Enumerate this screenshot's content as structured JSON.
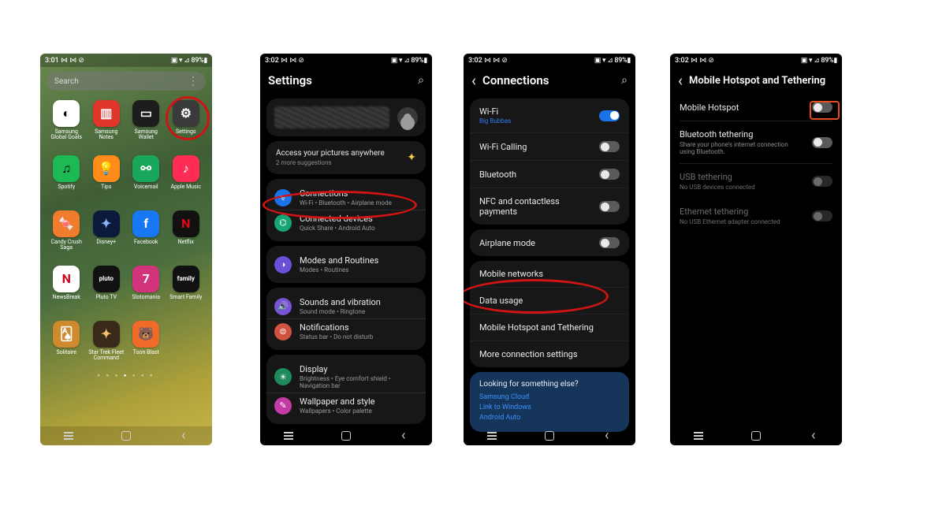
{
  "status": {
    "time1": "3:01",
    "time2": "3:02",
    "icons_left": " ⋈ ⋈ ⊘",
    "right": "▣ ▾ ⊿ 89%▮"
  },
  "screen1": {
    "search_placeholder": "Search",
    "apps": [
      {
        "label": "Samsung",
        "label2": "Global Goals",
        "bg": "#ffffff",
        "fg": "#000",
        "glyph": "◐"
      },
      {
        "label": "Samsung",
        "label2": "Notes",
        "bg": "#e0352b",
        "fg": "#fff",
        "glyph": "▥"
      },
      {
        "label": "Samsung",
        "label2": "Wallet",
        "bg": "#1d1d1d",
        "fg": "#fff",
        "glyph": "▭"
      },
      {
        "label": "Settings",
        "label2": "",
        "bg": "#3a3a3a",
        "fg": "#fff",
        "glyph": "⚙"
      },
      {
        "label": "Spotify",
        "label2": "",
        "bg": "#1db954",
        "fg": "#000",
        "glyph": "♫"
      },
      {
        "label": "Tips",
        "label2": "",
        "bg": "#ff8c1a",
        "fg": "#fff",
        "glyph": "💡"
      },
      {
        "label": "Voicemail",
        "label2": "",
        "bg": "#19a85b",
        "fg": "#fff",
        "glyph": "⚯"
      },
      {
        "label": "Apple Music",
        "label2": "",
        "bg": "#ff2d55",
        "fg": "#fff",
        "glyph": "♪"
      },
      {
        "label": "Candy Crush",
        "label2": "Saga",
        "bg": "#f07c2e",
        "fg": "#fff",
        "glyph": "🍬"
      },
      {
        "label": "Disney+",
        "label2": "",
        "bg": "#0b1a3a",
        "fg": "#8ab4ff",
        "glyph": "✦"
      },
      {
        "label": "Facebook",
        "label2": "",
        "bg": "#1877f2",
        "fg": "#fff",
        "glyph": "f"
      },
      {
        "label": "Netflix",
        "label2": "",
        "bg": "#111",
        "fg": "#e50914",
        "glyph": "N"
      },
      {
        "label": "NewsBreak",
        "label2": "",
        "bg": "#fff",
        "fg": "#d0021b",
        "glyph": "N"
      },
      {
        "label": "Pluto TV",
        "label2": "",
        "bg": "#111",
        "fg": "#fff",
        "glyph": "pluto"
      },
      {
        "label": "Slotomania",
        "label2": "",
        "bg": "#d2347b",
        "fg": "#fff",
        "glyph": "7"
      },
      {
        "label": "Smart Family",
        "label2": "",
        "bg": "#111",
        "fg": "#fff",
        "glyph": "family"
      },
      {
        "label": "Solitaire",
        "label2": "",
        "bg": "#cf8a2e",
        "fg": "#fff",
        "glyph": "🂡"
      },
      {
        "label": "Star Trek Fleet",
        "label2": "Command",
        "bg": "#3a2a1a",
        "fg": "#f3c067",
        "glyph": "✦"
      },
      {
        "label": "Toon Blast",
        "label2": "",
        "bg": "#f06a2a",
        "fg": "#fff",
        "glyph": "🐻"
      }
    ]
  },
  "screen2": {
    "title": "Settings",
    "suggest_title": "Access your pictures anywhere",
    "suggest_sub": "2 more suggestions",
    "groups": [
      [
        {
          "ic": "#1a73e8",
          "g": "ᯤ",
          "t": "Connections",
          "s": "Wi-Fi  •  Bluetooth  •  Airplane mode"
        },
        {
          "ic": "#17a673",
          "g": "⌬",
          "t": "Connected devices",
          "s": "Quick Share  •  Android Auto"
        }
      ],
      [
        {
          "ic": "#6b4fd8",
          "g": "◑",
          "t": "Modes and Routines",
          "s": "Modes  •  Routines"
        }
      ],
      [
        {
          "ic": "#7a52d6",
          "g": "🔊",
          "t": "Sounds and vibration",
          "s": "Sound mode  •  Ringtone"
        },
        {
          "ic": "#d0533f",
          "g": "⊜",
          "t": "Notifications",
          "s": "Status bar  •  Do not disturb"
        }
      ],
      [
        {
          "ic": "#1f8a5a",
          "g": "☀",
          "t": "Display",
          "s": "Brightness  •  Eye comfort shield  •  Navigation bar"
        },
        {
          "ic": "#c23ba7",
          "g": "✎",
          "t": "Wallpaper and style",
          "s": "Wallpapers  •  Color palette"
        }
      ]
    ]
  },
  "screen3": {
    "title": "Connections",
    "wifi_name": "Big Bubbas",
    "rows1": [
      {
        "t": "Wi-Fi",
        "s": "Big Bubbas",
        "on": true,
        "link": true
      },
      {
        "t": "Wi-Fi Calling",
        "on": false
      },
      {
        "t": "Bluetooth",
        "on": false
      },
      {
        "t": "NFC and contactless payments",
        "on": false
      }
    ],
    "rows2": [
      {
        "t": "Airplane mode",
        "on": false
      }
    ],
    "rows3": [
      {
        "t": "Mobile networks"
      },
      {
        "t": "Data usage"
      },
      {
        "t": "Mobile Hotspot and Tethering"
      },
      {
        "t": "More connection settings"
      }
    ],
    "blue": {
      "h": "Looking for something else?",
      "l1": "Samsung Cloud",
      "l2": "Link to Windows",
      "l3": "Android Auto"
    }
  },
  "screen4": {
    "title": "Mobile Hotspot and Tethering",
    "rows": [
      {
        "t": "Mobile Hotspot",
        "s": "",
        "on": false,
        "dim": false
      },
      {
        "t": "Bluetooth tethering",
        "s": "Share your phone's internet connection using Bluetooth.",
        "on": false,
        "dim": false
      },
      {
        "t": "USB tethering",
        "s": "No USB devices connected",
        "on": false,
        "dim": true
      },
      {
        "t": "Ethernet tethering",
        "s": "No USB Ethernet adapter connected",
        "on": false,
        "dim": true
      }
    ]
  }
}
